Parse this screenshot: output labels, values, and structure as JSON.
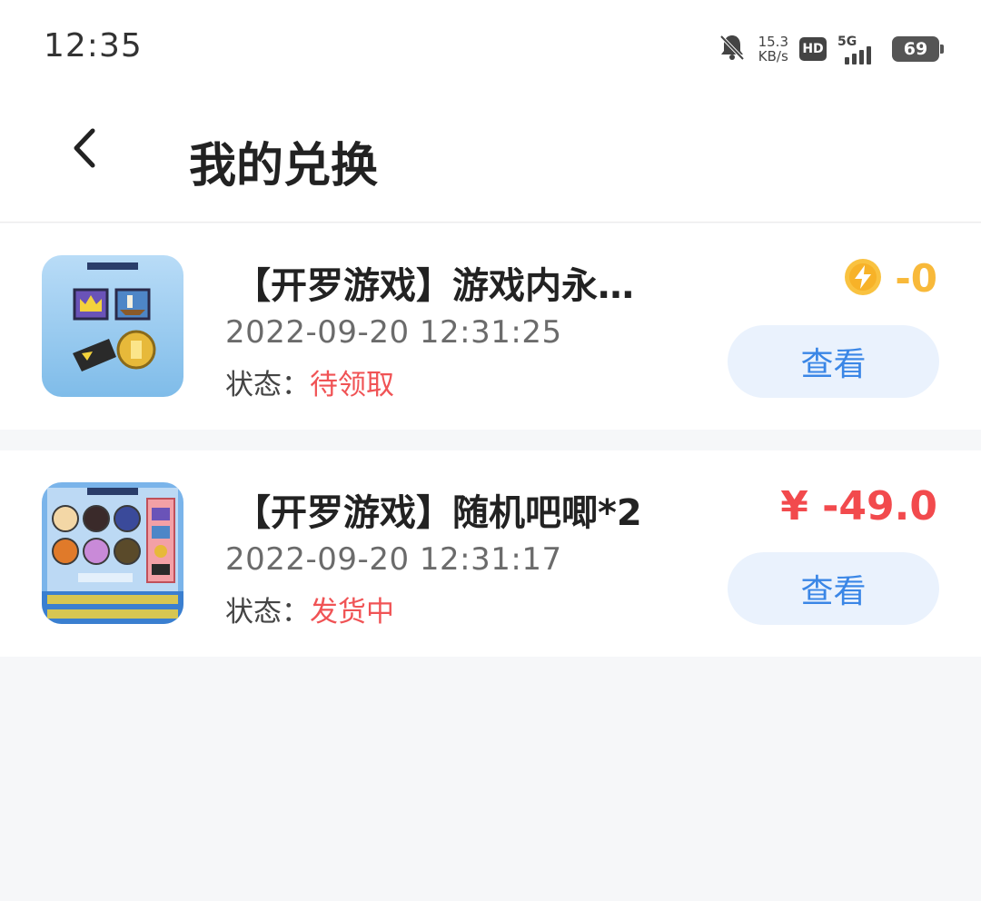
{
  "status_bar": {
    "time": "12:35",
    "net_speed_value": "15.3",
    "net_speed_unit": "KB/s",
    "hd_label": "HD",
    "network_label": "5G",
    "battery": "69"
  },
  "header": {
    "title": "我的兑换"
  },
  "orders": [
    {
      "title": "【开罗游戏】游戏内永…",
      "time": "2022-09-20  12:31:25",
      "status_label": "状态：",
      "status_value": "待领取",
      "price_icon": "coin-icon",
      "price": "-0",
      "button": "查看"
    },
    {
      "title": "【开罗游戏】随机吧唧*2",
      "time": "2022-09-20  12:31:17",
      "status_label": "状态：",
      "status_value": "发货中",
      "price": "¥ -49.0",
      "button": "查看"
    }
  ],
  "colors": {
    "coin": "#f8b93a",
    "price_red": "#f24a4d",
    "status_red": "#f05355",
    "button_bg": "#eaf2fd",
    "button_text": "#3a86e6"
  }
}
